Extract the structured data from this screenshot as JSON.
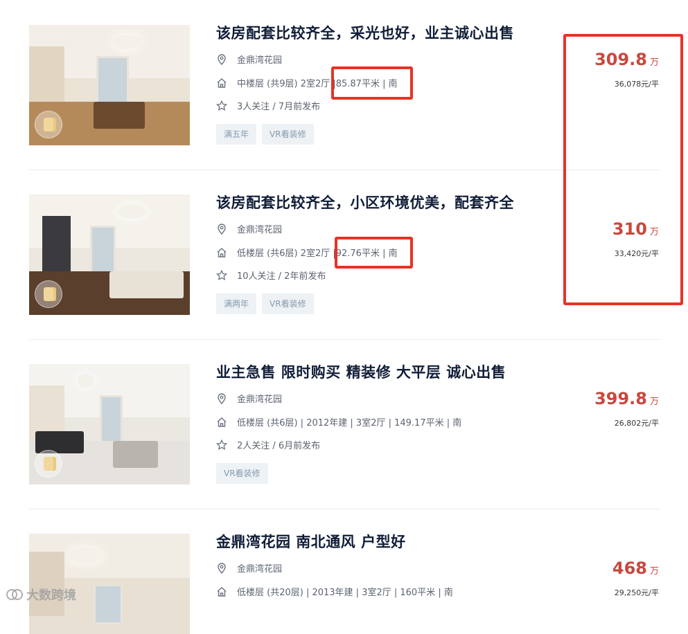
{
  "listings": [
    {
      "title": "该房配套比较齐全，采光也好，业主诚心出售",
      "community": "金鼎湾花园",
      "house_info_a": "中楼层 (共9层) 2室2厅 |",
      "house_info_b": " 85.87平米 | 南",
      "follow": "3人关注 / 7月前发布",
      "tags": [
        "满五年",
        "VR看装修"
      ],
      "price": "309.8",
      "unit": "万",
      "unit_price": "36,078元/平"
    },
    {
      "title": "该房配套比较齐全，小区环境优美，配套齐全",
      "community": "金鼎湾花园",
      "house_info_a": "低楼层 (共6层) 2室2厅 |",
      "house_info_b": " 92.76平米 | 南",
      "follow": "10人关注 / 2年前发布",
      "tags": [
        "满两年",
        "VR看装修"
      ],
      "price": "310",
      "unit": "万",
      "unit_price": "33,420元/平"
    },
    {
      "title": "业主急售 限时购买 精装修 大平层 诚心出售",
      "community": "金鼎湾花园",
      "house_info_a": "低楼层 (共6层) | 2012年建 | 3室2厅 | 149.17平米 | 南",
      "house_info_b": "",
      "follow": "2人关注 / 6月前发布",
      "tags": [
        "VR看装修"
      ],
      "price": "399.8",
      "unit": "万",
      "unit_price": "26,802元/平"
    },
    {
      "title": "金鼎湾花园 南北通风 户型好",
      "community": "金鼎湾花园",
      "house_info_a": "低楼层 (共20层) | 2013年建 | 3室2厅 | 160平米 | 南",
      "house_info_b": "",
      "follow": "",
      "tags": [],
      "price": "468",
      "unit": "万",
      "unit_price": "29,250元/平"
    }
  ],
  "icons": {
    "location": "location-pin-icon",
    "house": "house-icon",
    "follow": "star-icon",
    "vr": "vr-badge-icon"
  },
  "colors": {
    "price": "#c9483d",
    "highlight": "#e53326",
    "title": "#101d37",
    "tag_bg": "#eef2f5",
    "tag_text": "#849aae"
  },
  "watermark": "大数跨境"
}
